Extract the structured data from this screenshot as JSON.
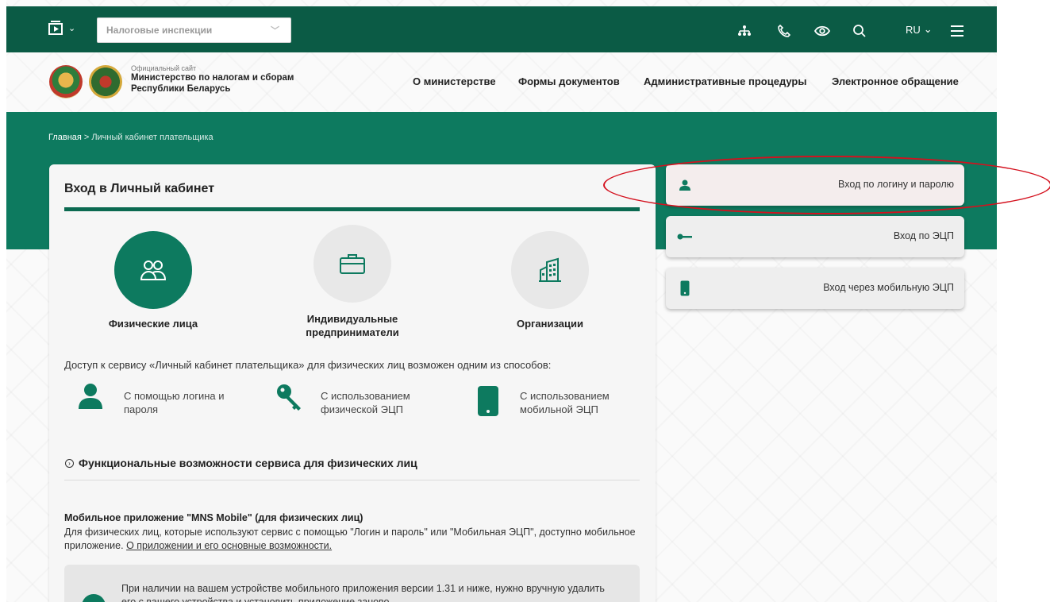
{
  "topbar": {
    "region_select": "Налоговые инспекции",
    "lang": "RU",
    "icons": [
      "media-icon",
      "sitemap-icon",
      "phone-icon",
      "eye-icon",
      "search-icon",
      "menu-icon"
    ]
  },
  "header": {
    "site_label": "Официальный сайт",
    "site_name_line1": "Министерство по налогам и сборам",
    "site_name_line2": "Республики Беларусь",
    "nav": [
      "О министерстве",
      "Формы документов",
      "Административные процедуры",
      "Электронное обращение"
    ]
  },
  "breadcrumb": {
    "home": "Главная",
    "separator": ">",
    "current": "Личный кабинет плательщика"
  },
  "card": {
    "title": "Вход в Личный кабинет",
    "categories": [
      {
        "label": "Физические лица",
        "icon": "users-icon",
        "active": true
      },
      {
        "label": "Индивидуальные предприниматели",
        "icon": "briefcase-icon",
        "active": false
      },
      {
        "label": "Организации",
        "icon": "building-icon",
        "active": false
      }
    ],
    "access_text": "Доступ к сервису «Личный кабинет плательщика» для физических лиц возможен одним из способов:",
    "methods": [
      {
        "line1": "С помощью логина и",
        "line2": "пароля",
        "icon": "person-icon"
      },
      {
        "line1": "С использованием",
        "line2": "физической ЭЦП",
        "icon": "key-icon"
      },
      {
        "line1": "С использованием",
        "line2": "мобильной ЭЦП",
        "icon": "phone-icon"
      }
    ],
    "features_title": "Функциональные возможности сервиса для физических лиц",
    "app_title": "Мобильное приложение \"MNS Mobile\" (для физических лиц)",
    "app_desc": "Для физических лиц, которые используют сервис с помощью \"Логин и пароль\" или \"Мобильная ЭЦП\", доступно мобильное приложение.",
    "app_link": "О приложении и его основные возможности.",
    "notice": "При наличии на вашем устройстве мобильного приложения версии 1.31 и ниже, нужно вручную удалить его с вашего устройства и установить приложение заново."
  },
  "login_options": [
    {
      "label": "Вход по логину и паролю",
      "icon": "person-icon",
      "active": true
    },
    {
      "label": "Вход по ЭЦП",
      "icon": "key-icon",
      "active": false
    },
    {
      "label": "Вход через мобильную ЭЦП",
      "icon": "mobile-icon",
      "active": false
    }
  ],
  "colors": {
    "brand_dark": "#0b5b45",
    "brand": "#0d7a5f",
    "annotation": "#d4111e"
  }
}
